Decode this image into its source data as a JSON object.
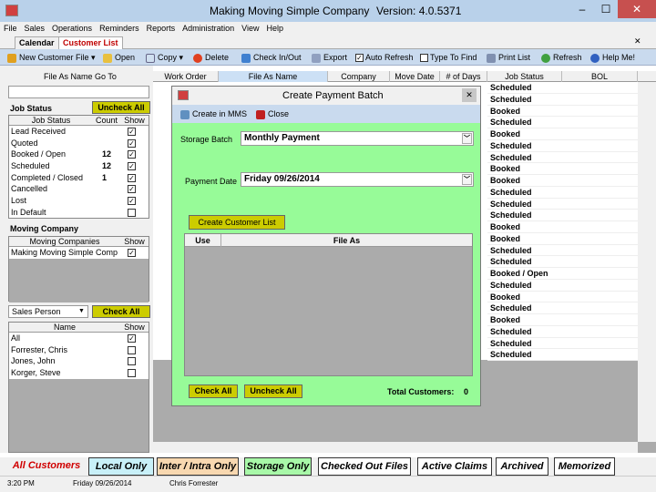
{
  "window": {
    "title": "Making Moving Simple Company",
    "version": "Version: 4.0.5371",
    "minimize": "–",
    "maximize": "☐",
    "close": "✕"
  },
  "menu": [
    "File",
    "Sales",
    "Operations",
    "Reminders",
    "Reports",
    "Administration",
    "View",
    "Help"
  ],
  "tabs": [
    {
      "label": "Calendar",
      "active": false
    },
    {
      "label": "Customer List",
      "active": true
    }
  ],
  "toolbar": {
    "new_customer": "New Customer File",
    "open": "Open",
    "copy": "Copy",
    "delete": "Delete",
    "checkinout": "Check In/Out",
    "export": "Export",
    "auto_refresh": "Auto Refresh",
    "auto_refresh_checked": true,
    "type_to_find": "Type To Find",
    "type_to_find_checked": false,
    "print_list": "Print List",
    "refresh": "Refresh",
    "help": "Help Me!"
  },
  "left": {
    "goto_label": "File As Name Go To",
    "goto_value": "",
    "job_status_label": "Job Status",
    "uncheck_all": "Uncheck All",
    "job_status_headers": [
      "Job Status",
      "Count",
      "Show"
    ],
    "job_statuses": [
      {
        "name": "Lead Received",
        "count": "",
        "show": true
      },
      {
        "name": "Quoted",
        "count": "",
        "show": true
      },
      {
        "name": "Booked / Open",
        "count": "12",
        "show": true
      },
      {
        "name": "Scheduled",
        "count": "12",
        "show": true
      },
      {
        "name": "Completed / Closed",
        "count": "1",
        "show": true
      },
      {
        "name": "Cancelled",
        "count": "",
        "show": true
      },
      {
        "name": "Lost",
        "count": "",
        "show": true
      },
      {
        "name": "In Default",
        "count": "",
        "show": false
      }
    ],
    "moving_company_label": "Moving Company",
    "moving_headers": [
      "Moving Companies",
      "Show"
    ],
    "moving_companies": [
      {
        "name": "Making Moving Simple Comp",
        "show": true
      }
    ],
    "person_select": "Sales Person",
    "check_all": "Check All",
    "person_headers": [
      "Name",
      "Show"
    ],
    "persons": [
      {
        "name": "All",
        "show": true
      },
      {
        "name": "Forrester, Chris",
        "show": false
      },
      {
        "name": "Jones, John",
        "show": false
      },
      {
        "name": "Korger, Steve",
        "show": false
      }
    ]
  },
  "grid": {
    "headers": [
      "Work Order",
      "File As Name",
      "Company",
      "Move Date",
      "# of Days",
      "Job Status",
      "BOL"
    ],
    "job_statuses": [
      "Scheduled",
      "Scheduled",
      "Booked",
      "Scheduled",
      "Booked",
      "Scheduled",
      "Scheduled",
      "Booked",
      "Booked",
      "Scheduled",
      "Scheduled",
      "Scheduled",
      "Booked",
      "Booked",
      "Scheduled",
      "Scheduled",
      "Booked / Open",
      "Scheduled",
      "Booked",
      "Scheduled",
      "Booked",
      "Scheduled",
      "Scheduled",
      "Scheduled"
    ]
  },
  "dialog": {
    "title": "Create Payment Batch",
    "create_in_mms": "Create in MMS",
    "close": "Close",
    "storage_batch_label": "Storage Batch",
    "storage_batch_value": "Monthly Payment",
    "payment_date_label": "Payment Date",
    "payment_date_value": "Friday  09/26/2014",
    "create_list": "Create Customer List",
    "list_headers": [
      "Use",
      "File As"
    ],
    "check_all": "Check All",
    "uncheck_all": "Uncheck All",
    "total_label": "Total Customers:",
    "total_value": "0"
  },
  "bottom_tabs": [
    {
      "label": "All Customers",
      "color": "#f0f0f0",
      "text": "#d00000"
    },
    {
      "label": "Local Only",
      "color": "#c8f0f8",
      "text": "#000"
    },
    {
      "label": "Inter / Intra Only",
      "color": "#f8d8b0",
      "text": "#000"
    },
    {
      "label": "Storage Only",
      "color": "#a8f8a8",
      "text": "#000"
    },
    {
      "label": "Checked Out Files",
      "color": "#ffffff",
      "text": "#000"
    },
    {
      "label": "Active Claims",
      "color": "#ffffff",
      "text": "#000"
    },
    {
      "label": "Archived",
      "color": "#ffffff",
      "text": "#000"
    },
    {
      "label": "Memorized",
      "color": "#ffffff",
      "text": "#000"
    }
  ],
  "status": {
    "time": "3:20 PM",
    "date": "Friday 09/26/2014",
    "user": "Chris Forrester"
  }
}
